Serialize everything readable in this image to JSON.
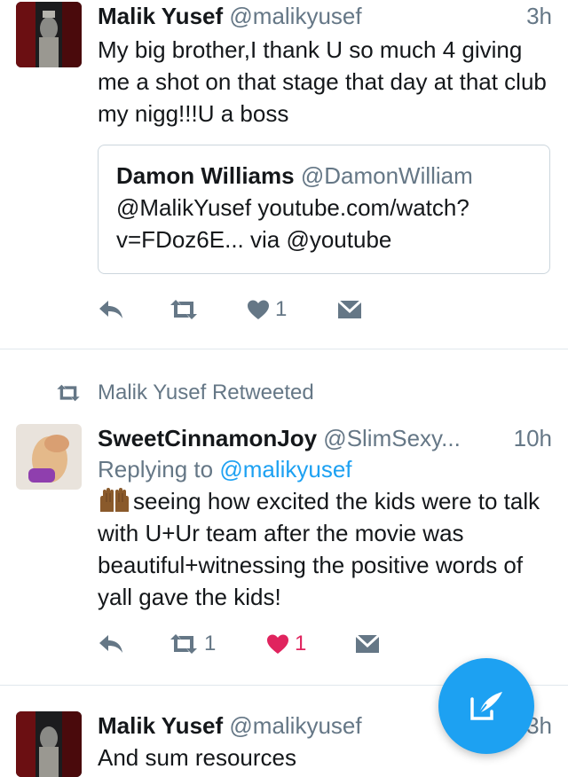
{
  "tweet1": {
    "name": "Malik Yusef",
    "handle": "@malikyusef",
    "time": "3h",
    "text": "My big brother,I thank U so much 4 giving me a shot on that stage that day at that club my nigg!!!U a boss",
    "quote": {
      "name": "Damon Williams",
      "handle": "@DamonWilliam",
      "text_line1": "@MalikYusef youtube.com/watch?",
      "text_line2": "v=FDoz6E... via @youtube"
    },
    "likes": "1",
    "retweets": ""
  },
  "retweet_banner": "Malik Yusef Retweeted",
  "tweet2": {
    "name": "SweetCinnamonJoy",
    "handle": "@SlimSexy...",
    "time": "10h",
    "replying_prefix": "Replying to",
    "replying_handle": "@malikyusef",
    "text": "seeing how excited the kids were to talk with U+Ur team after the movie was beautiful+witnessing the positive words of yall gave the kids!",
    "retweets": "1",
    "likes": "1"
  },
  "tweet3": {
    "name": "Malik Yusef",
    "handle": "@malikyusef",
    "time": "3h",
    "text": "And sum resources"
  },
  "colors": {
    "accent": "#1da1f2",
    "like_red": "#e0245e",
    "secondary": "#657786"
  },
  "icons": {
    "reply": "reply-icon",
    "retweet": "retweet-icon",
    "like": "heart-icon",
    "dm": "envelope-icon",
    "compose": "compose-icon"
  }
}
